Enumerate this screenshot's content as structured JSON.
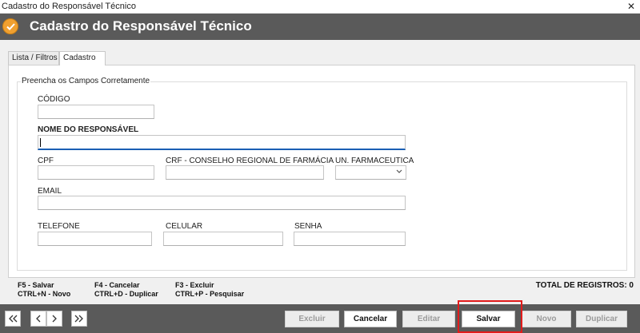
{
  "window": {
    "title": "Cadastro do Responsável Técnico",
    "close_glyph": "✕"
  },
  "header": {
    "title": "Cadastro do Responsável Técnico",
    "icon": "check-circle-icon",
    "accent": "#f0a030"
  },
  "tabs": [
    {
      "label": "Lista / Filtros",
      "active": false
    },
    {
      "label": "Cadastro",
      "active": true
    }
  ],
  "form": {
    "group_label": "Preencha os Campos Corretamente",
    "codigo": {
      "label": "CÓDIGO",
      "value": ""
    },
    "nome": {
      "label": "NOME DO RESPONSÁVEL",
      "value": ""
    },
    "cpf": {
      "label": "CPF",
      "value": ""
    },
    "crf": {
      "label": "CRF - CONSELHO REGIONAL DE FARMÁCIA",
      "value": ""
    },
    "un_farmaceutica": {
      "label": "UN. FARMACEUTICA",
      "value": ""
    },
    "email": {
      "label": "EMAIL",
      "value": ""
    },
    "telefone": {
      "label": "TELEFONE",
      "value": ""
    },
    "celular": {
      "label": "CELULAR",
      "value": ""
    },
    "senha": {
      "label": "SENHA",
      "value": ""
    }
  },
  "shortcuts": {
    "col1": [
      "F5 - Salvar",
      "CTRL+N - Novo"
    ],
    "col2": [
      "F4 - Cancelar",
      "CTRL+D - Duplicar"
    ],
    "col3": [
      "F3 - Excluir",
      "CTRL+P - Pesquisar"
    ]
  },
  "total_registros": "TOTAL DE REGISTROS: 0",
  "navigation": {
    "first": "«",
    "prev": "‹",
    "next": "›",
    "last": "»"
  },
  "actions": {
    "excluir": {
      "label": "Excluir",
      "enabled": false
    },
    "cancelar": {
      "label": "Cancelar",
      "enabled": true
    },
    "editar": {
      "label": "Editar",
      "enabled": false
    },
    "salvar": {
      "label": "Salvar",
      "enabled": true,
      "highlighted": true,
      "highlight_color": "#e21b1b"
    },
    "novo": {
      "label": "Novo",
      "enabled": false
    },
    "duplicar": {
      "label": "Duplicar",
      "enabled": false
    }
  }
}
